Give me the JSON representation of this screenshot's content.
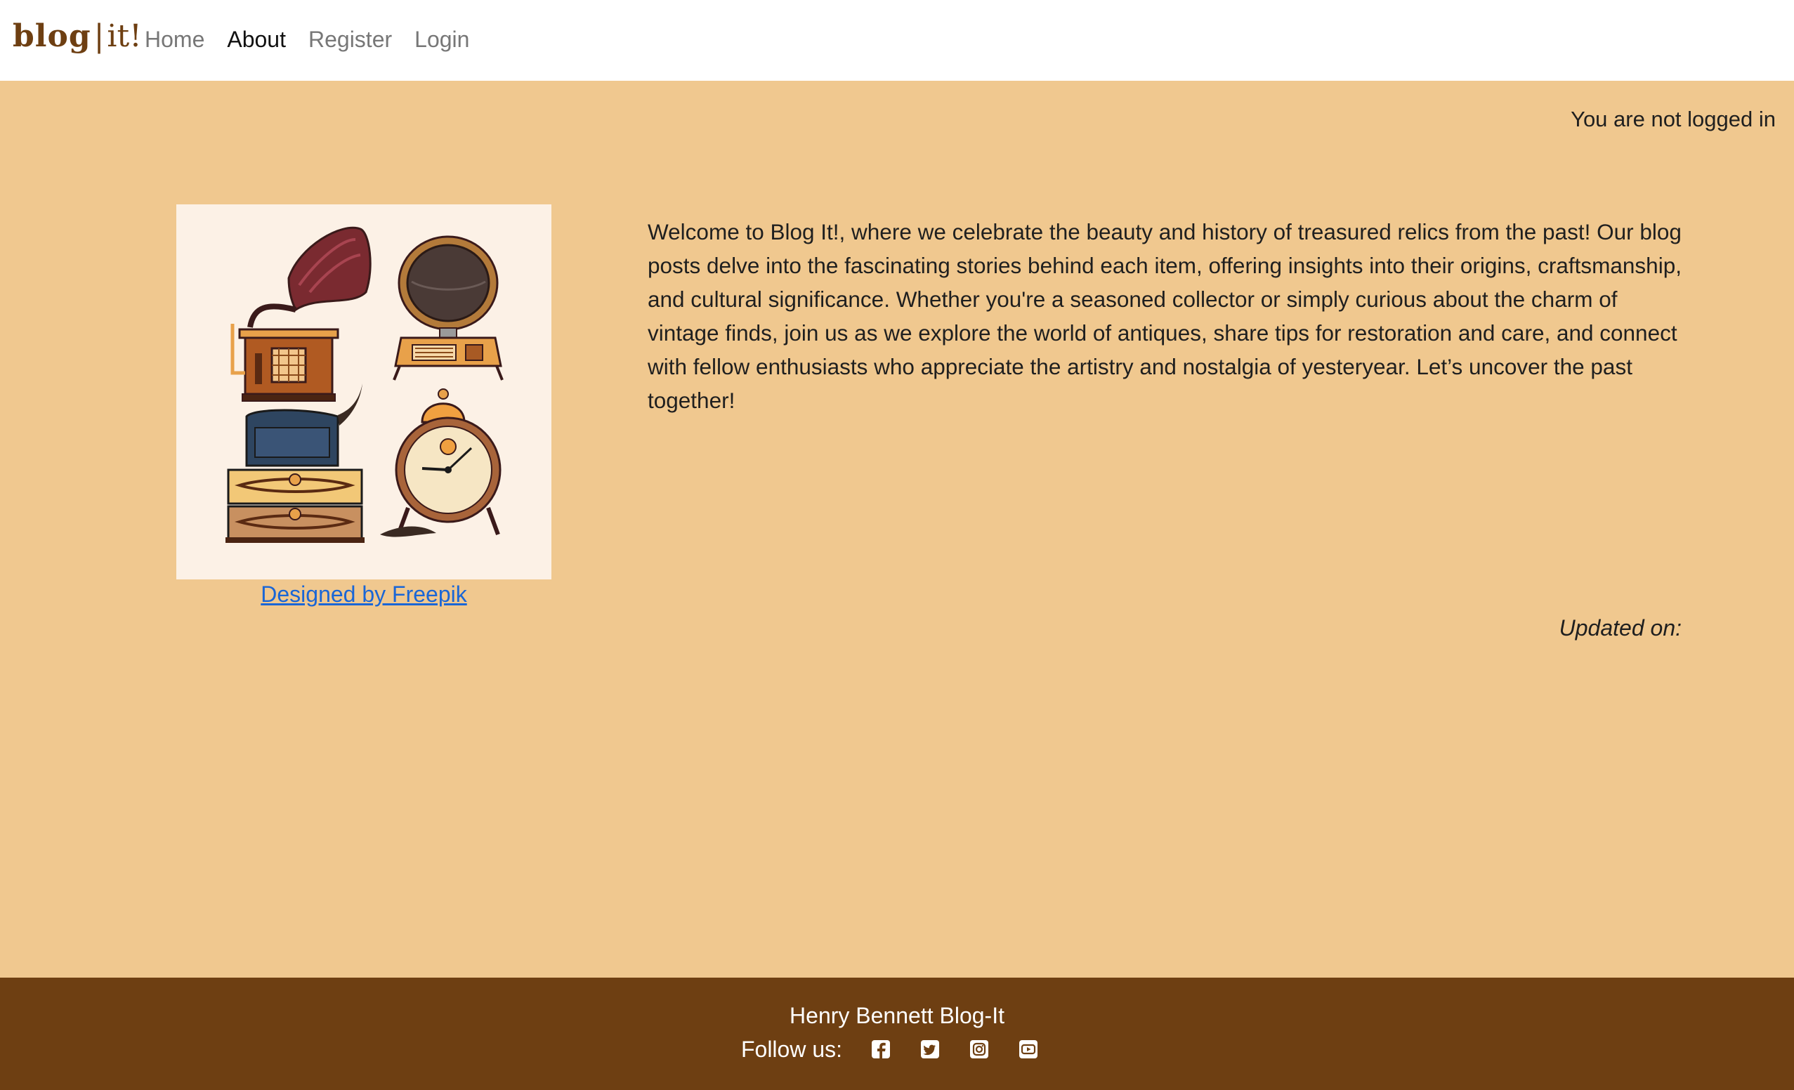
{
  "brand": {
    "part1": "blog",
    "separator": "|",
    "part2": "it!"
  },
  "nav": {
    "items": [
      {
        "label": "Home",
        "active": false
      },
      {
        "label": "About",
        "active": true
      },
      {
        "label": "Register",
        "active": false
      },
      {
        "label": "Login",
        "active": false
      }
    ]
  },
  "status": {
    "login_text": "You are not logged in"
  },
  "illustration": {
    "icons": [
      "gramophone-icon",
      "vintage-radio-icon",
      "vintage-suitcases-icon",
      "alarm-clock-icon"
    ],
    "credit_link": "Designed by Freepik"
  },
  "article": {
    "intro": "Welcome to Blog It!, where we celebrate the beauty and history of treasured relics from the past! Our blog posts delve into the fascinating stories behind each item, offering insights into their origins, craftsmanship, and cultural significance. Whether you're a seasoned collector or simply curious about the charm of vintage finds, join us as we explore the world of antiques, share tips for restoration and care, and connect with fellow enthusiasts who appreciate the artistry and nostalgia of yesteryear. Let’s uncover the past together!",
    "updated_label": "Updated on:"
  },
  "footer": {
    "title": "Henry Bennett Blog-It",
    "follow_label": "Follow us:",
    "socials": [
      "facebook-icon",
      "twitter-icon",
      "instagram-icon",
      "youtube-icon"
    ]
  },
  "colors": {
    "page_background": "#f0c88f",
    "footer_background": "#6e3f12",
    "brand": "#6e3f12",
    "link": "#1a66d6"
  }
}
